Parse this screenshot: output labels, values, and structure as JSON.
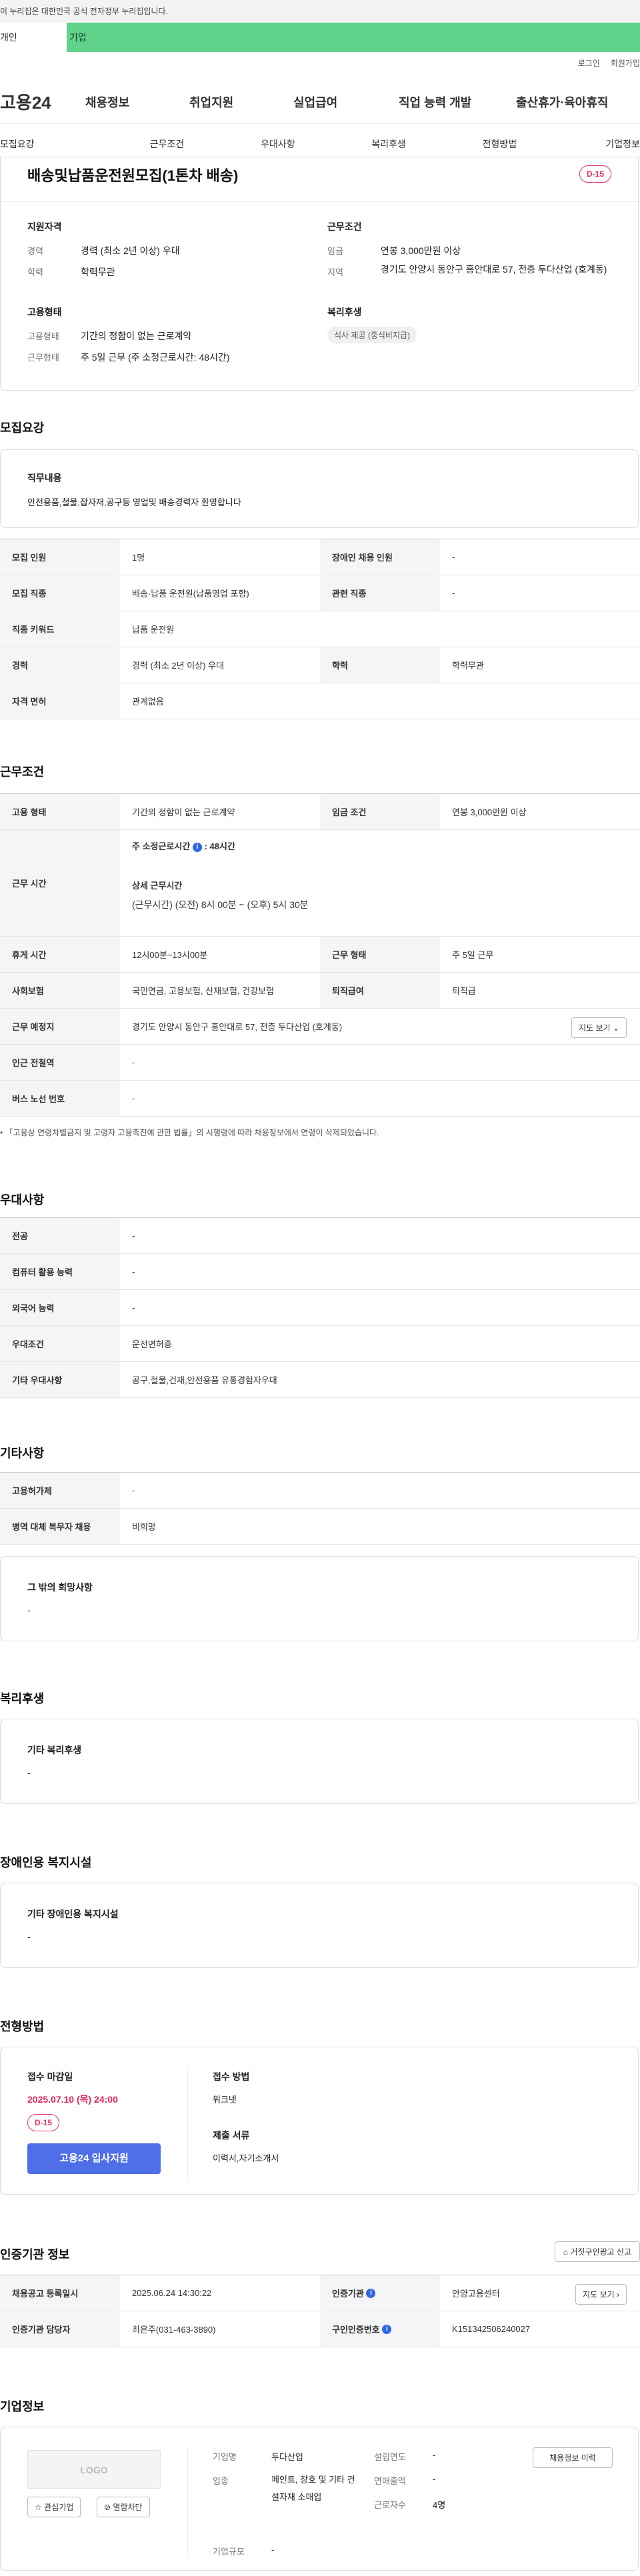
{
  "gov_banner": "이 누리집은 대한민국 공식 전자정부 누리집입니다.",
  "top_tabs": {
    "individual": "개인",
    "company": "기업"
  },
  "util": {
    "login": "로그인",
    "join": "회원가입"
  },
  "logo": "고용24",
  "gnb": [
    "채용정보",
    "취업지원",
    "실업급여",
    "직업 능력 개발",
    "출산휴가·육아휴직"
  ],
  "subnav": [
    "모집요강",
    "근무조건",
    "우대사항",
    "복리후생",
    "전형방법",
    "기업정보"
  ],
  "job": {
    "title": "배송및납품운전원모집(1톤차 배송)",
    "dday": "D-15",
    "qual_h": "지원자격",
    "cond_h": "근무조건",
    "type_h": "고용형태",
    "welfare_h": "복리후생",
    "career_l": "경력",
    "career_v": "경력 (최소 2년 이상) 우대",
    "edu_l": "학력",
    "edu_v": "학력무관",
    "wage_l": "임금",
    "wage_v": "연봉 3,000만원 이상",
    "region_l": "지역",
    "region_v": "경기도 안양시 동안구 흥안대로 57, 전층 두다산업 (호계동)",
    "emp_l": "고용형태",
    "emp_v": "기간의 정함이 없는 근로계약",
    "work_l": "근무형태",
    "work_v": "주 5일 근무 (주 소정근로시간: 48시간)",
    "welfare_chip": "식사 제공 (중식비지급)"
  },
  "recruit": {
    "heading": "모집요강",
    "duty_h": "직무내용",
    "duty_v": "안전용품,철물,잡자재,공구등 영업및 배송경력자 환영합니다",
    "rows": [
      [
        "모집 인원",
        "1명",
        "장애인 채용 인원",
        "-"
      ],
      [
        "모집 직종",
        "배송·납품 운전원(납품영업 포함)",
        "관련 직종",
        "-"
      ],
      [
        "직종 키워드",
        "납품 운전원"
      ],
      [
        "경력",
        "경력 (최소 2년 이상) 우대",
        "학력",
        "학력무관"
      ],
      [
        "자격 면허",
        "관계없음"
      ]
    ]
  },
  "conditions": {
    "heading": "근무조건",
    "emp_th": "고용 형태",
    "emp_td": "기간의 정함이 없는 근로계약",
    "wage_th": "임금 조건",
    "wage_td": "연봉 3,000만원 이상",
    "hours_th": "근무 시간",
    "hours_week": "주 소정근로시간",
    "hours_week_v": ": 48시간",
    "hours_detail_h": "상세 근무시간",
    "hours_detail_v": "(근무시간) (오전) 8시 00분 ~ (오후) 5시 30분",
    "rest_th": "휴게 시간",
    "rest_td": "12시00분~13시00분",
    "form_th": "근무 형태",
    "form_td": "주 5일 근무",
    "ins_th": "사회보험",
    "ins_td": "국민연금, 고용보험, 산재보험, 건강보험",
    "retire_th": "퇴직급여",
    "retire_td": "퇴직급",
    "place_th": "근무 예정지",
    "place_td": "경기도 안양시 동안구 흥안대로 57, 전층 두다산업 (호계동)",
    "map_btn": "지도 보기",
    "subway_th": "인근 전철역",
    "subway_td": "-",
    "bus_th": "버스 노선 번호",
    "bus_td": "-",
    "note": "「고용상 연령차별금지 및 고령자 고용촉진에 관한 법률」의 시행령에 따라 채용정보에서 연령이 삭제되었습니다."
  },
  "prefer": {
    "heading": "우대사항",
    "rows": [
      [
        "전공",
        "-"
      ],
      [
        "컴퓨터 활용 능력",
        "-"
      ],
      [
        "외국어 능력",
        "-"
      ],
      [
        "우대조건",
        "운전면허증"
      ],
      [
        "기타 우대사항",
        "공구,철물,건재,안전용품 유통경험자우대"
      ]
    ]
  },
  "etc": {
    "heading": "기타사항",
    "rows": [
      [
        "고용허가제",
        "-"
      ],
      [
        "병역 대체 복무자 채용",
        "비희망"
      ]
    ],
    "other_h": "그 밖의 희망사항",
    "other_v": "-"
  },
  "welfare": {
    "heading": "복리후생",
    "sub_h": "기타 복리후생",
    "sub_v": "-"
  },
  "disabled": {
    "heading": "장애인용 복지시설",
    "sub_h": "기타 장애인용 복지시설",
    "sub_v": "-"
  },
  "selection": {
    "heading": "전형방법",
    "deadline_h": "접수 마감일",
    "deadline_v": "2025.07.10 (목) 24:00",
    "dday": "D-15",
    "apply_btn": "고용24 입사지원",
    "method_h": "접수 방법",
    "method_v": "워크넷",
    "docs_h": "제출 서류",
    "docs_v": "이력서,자기소개서"
  },
  "cert": {
    "heading": "인증기관 정보",
    "report_btn": "거짓구인광고 신고",
    "reg_th": "채용공고 등록일시",
    "reg_td": "2025.06.24 14:30:22",
    "org_th": "인증기관",
    "org_td": "안양고용센터",
    "map_btn": "지도 보기",
    "mgr_th": "인증기관 담당자",
    "mgr_td": "최은주(031-463-3890)",
    "num_th": "구인인증번호",
    "num_td": "K151342506240027"
  },
  "company": {
    "heading": "기업정보",
    "logo": "LOGO",
    "fav_btn": "관심기업",
    "block_btn": "열람차단",
    "name_l": "기업명",
    "name_v": "두다산업",
    "ind_l": "업종",
    "ind_v": "페인트, 창호 및 기타 건설자재 소매업",
    "scale_l": "기업규모",
    "scale_v": "-",
    "est_l": "설립연도",
    "est_v": "-",
    "sales_l": "연매출액",
    "sales_v": "-",
    "emp_l": "근로자수",
    "emp_v": "4명",
    "history_btn": "채용정보 이력"
  }
}
